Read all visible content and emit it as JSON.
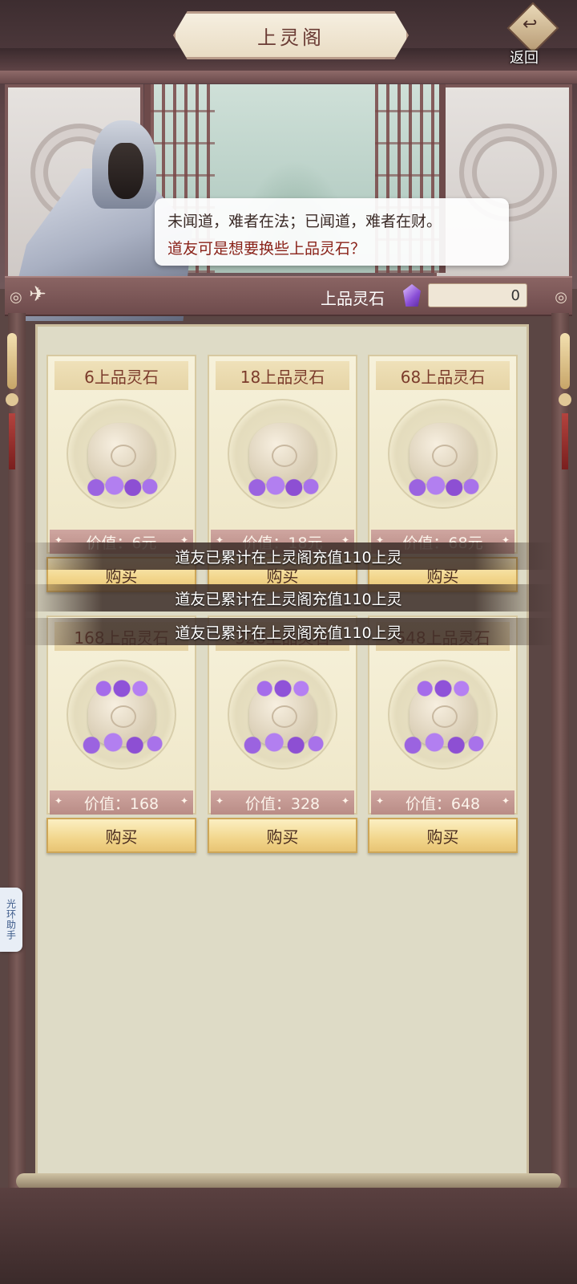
{
  "header": {
    "title": "上灵阁",
    "back_label": "返回"
  },
  "npc": {
    "dialog_line1": "未闻道，难者在法；已闻道，难者在财。",
    "dialog_line2": "道友可是想要换些上品灵石？"
  },
  "currency": {
    "label": "上品灵石",
    "value": "0",
    "icon": "purple-gem-icon"
  },
  "shop": {
    "items": [
      {
        "name": "6上品灵石",
        "price": "价值：6元",
        "buy": "购买"
      },
      {
        "name": "18上品灵石",
        "price": "价值：18元",
        "buy": "购买"
      },
      {
        "name": "68上品灵石",
        "price": "价值：68元",
        "buy": "购买"
      },
      {
        "name": "168上品灵石",
        "price": "价值：168",
        "buy": "购买"
      },
      {
        "name": "328上品灵石",
        "price": "价值：328",
        "buy": "购买"
      },
      {
        "name": "648上品灵石",
        "price": "价值：648",
        "buy": "购买"
      }
    ]
  },
  "toasts": [
    "道友已累计在上灵阁充值110上灵",
    "道友已累计在上灵阁充值110上灵",
    "道友已累计在上灵阁充值110上灵"
  ],
  "helper": {
    "label": "光环助手"
  },
  "colors": {
    "accent_red": "#8a2219",
    "gem_purple": "#8a4fd6",
    "button_gold": "#f2d68c"
  }
}
